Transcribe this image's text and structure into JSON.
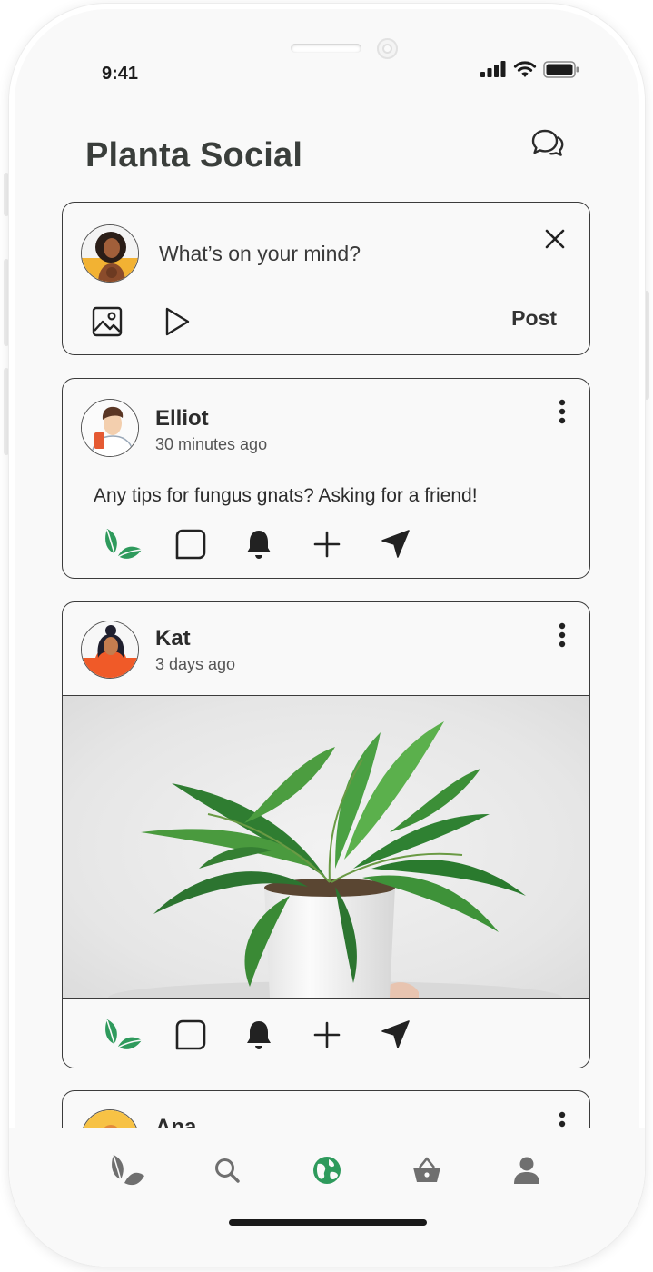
{
  "status_bar": {
    "time": "9:41"
  },
  "header": {
    "title": "Planta Social",
    "chat_icon": "chat-bubbles-icon"
  },
  "composer": {
    "placeholder": "What’s on your mind?",
    "post_label": "Post",
    "icons": [
      "image-icon",
      "video-play-icon",
      "close-icon"
    ]
  },
  "posts": [
    {
      "author": "Elliot",
      "time": "30 minutes ago",
      "text": "Any tips for fungus gnats? Asking for a friend!"
    },
    {
      "author": "Kat",
      "time": "3 days ago",
      "image": "potted-plant-photo"
    },
    {
      "author": "Ana"
    }
  ],
  "action_icons": [
    "leaf-like-icon",
    "comment-icon",
    "bell-icon",
    "plus-icon",
    "send-icon"
  ],
  "nav": {
    "items": [
      "plants-icon",
      "search-icon",
      "globe-icon",
      "shop-basket-icon",
      "profile-icon"
    ],
    "active": "globe-icon"
  },
  "colors": {
    "accent": "#2e9a5c",
    "text": "#2b2b2b",
    "background": "#f9f9f9",
    "icon_gray": "#6f6f6f"
  }
}
